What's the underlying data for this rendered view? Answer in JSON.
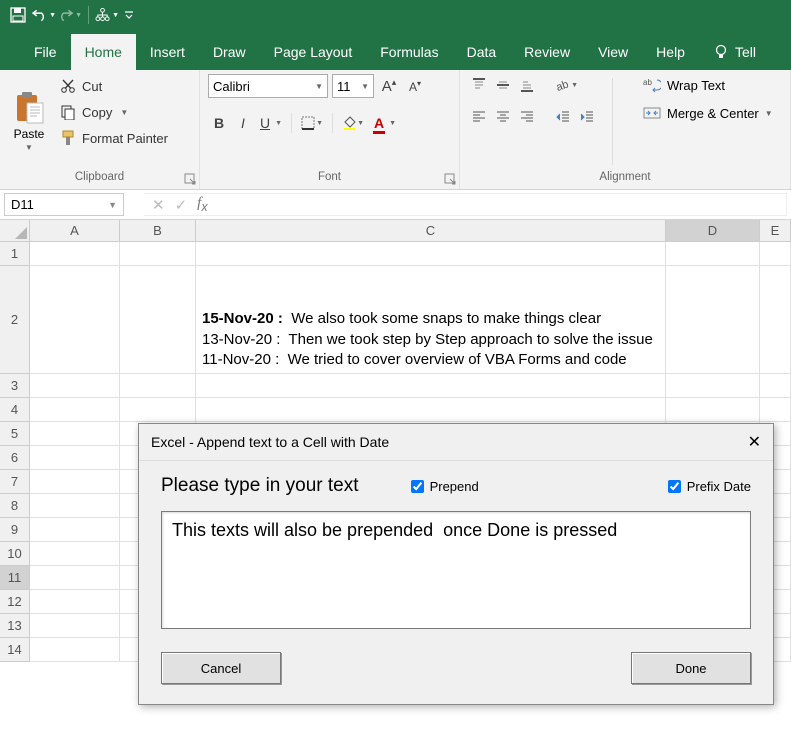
{
  "qat": {
    "save": "💾",
    "undo": "↶",
    "redo": "↷"
  },
  "tabs": {
    "file": "File",
    "home": "Home",
    "insert": "Insert",
    "draw": "Draw",
    "pagelayout": "Page Layout",
    "formulas": "Formulas",
    "data": "Data",
    "review": "Review",
    "view": "View",
    "help": "Help",
    "tell": "Tell"
  },
  "ribbon": {
    "clipboard": {
      "paste": "Paste",
      "cut": "Cut",
      "copy": "Copy",
      "formatpainter": "Format Painter",
      "label": "Clipboard"
    },
    "font": {
      "name": "Calibri",
      "size": "11",
      "label": "Font"
    },
    "alignment": {
      "wraptext": "Wrap Text",
      "mergecenter": "Merge & Center",
      "label": "Alignment"
    }
  },
  "namebox": "D11",
  "columns": [
    "A",
    "B",
    "C",
    "D",
    "E"
  ],
  "rows": [
    "1",
    "2",
    "3",
    "4",
    "5",
    "6",
    "7",
    "8",
    "9",
    "10",
    "11",
    "12",
    "13",
    "14"
  ],
  "cellC2": {
    "line1_date": "15-Nov-20 :",
    "line1_text": "  We also took some snaps to make things clear",
    "line2": "13-Nov-20 :  Then we took step by Step approach to solve the issue",
    "line3": "11-Nov-20 :  We tried to cover overview of VBA Forms and code"
  },
  "dialog": {
    "title": "Excel - Append text to a Cell with Date",
    "prompt": "Please type in your text",
    "prepend": "Prepend",
    "prefixdate": "Prefix Date",
    "text": "This texts will also be prepended  once Done is pressed",
    "cancel": "Cancel",
    "done": "Done",
    "prepend_checked": true,
    "prefixdate_checked": true
  }
}
